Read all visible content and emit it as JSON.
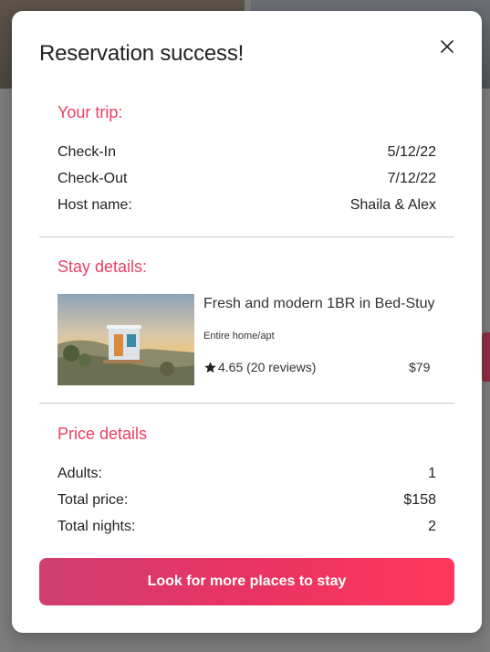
{
  "modal": {
    "title": "Reservation success!",
    "close_icon": "close-icon"
  },
  "trip": {
    "heading": "Your trip:",
    "rows": [
      {
        "label": "Check-In",
        "value": "5/12/22"
      },
      {
        "label": "Check-Out",
        "value": "7/12/22"
      },
      {
        "label": "Host name:",
        "value": "Shaila & Alex"
      }
    ]
  },
  "stay": {
    "heading": "Stay details:",
    "title": "Fresh and modern 1BR in Bed-Stuy",
    "type": "Entire home/apt",
    "rating": "4.65 (20 reviews)",
    "price": "$79",
    "star_icon": "star-icon"
  },
  "price": {
    "heading": "Price details",
    "rows": [
      {
        "label": "Adults:",
        "value": "1"
      },
      {
        "label": "Total price:",
        "value": "$158"
      },
      {
        "label": "Total nights:",
        "value": "2"
      }
    ]
  },
  "cta": {
    "label": "Look for more places to stay"
  },
  "colors": {
    "accent": "#ee3e62",
    "cta_start": "#d03e72",
    "cta_end": "#ff385c"
  }
}
